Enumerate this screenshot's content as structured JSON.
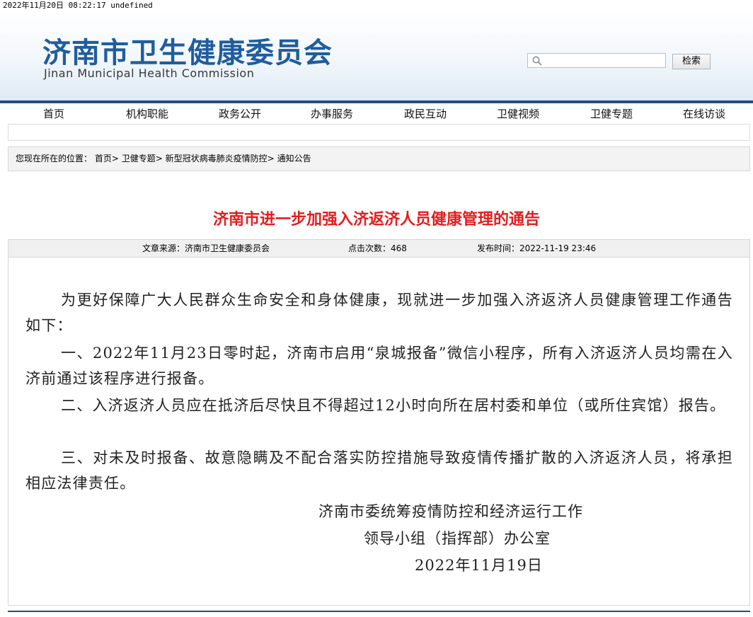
{
  "timestamp": "2022年11月20日  08:22:17  undefined",
  "header": {
    "name_cn": "济南市卫生健康委员会",
    "name_en": "Jinan Municipal Health Commission",
    "search_placeholder": "",
    "search_button": "检索"
  },
  "nav": {
    "items": [
      {
        "label": "首页"
      },
      {
        "label": "机构职能"
      },
      {
        "label": "政务公开"
      },
      {
        "label": "办事服务"
      },
      {
        "label": "政民互动"
      },
      {
        "label": "卫健视频"
      },
      {
        "label": "卫健专题"
      },
      {
        "label": "在线访谈"
      }
    ]
  },
  "breadcrumb": {
    "prefix": "您现在所在的位置：",
    "items": [
      {
        "label": "首页"
      },
      {
        "label": "卫健专题"
      },
      {
        "label": "新型冠状病毒肺炎疫情防控"
      },
      {
        "label": "通知公告"
      }
    ],
    "separator": ">"
  },
  "article": {
    "title": "济南市进一步加强入济返济人员健康管理的通告",
    "source": "文章来源：济南市卫生健康委员会",
    "views": "点击次数：468",
    "published": "发布时间：2022-11-19 23:46",
    "paragraphs": [
      "为更好保障广大人民群众生命安全和身体健康，现就进一步加强入济返济人员健康管理工作通告如下：",
      "一、2022年11月23日零时起，济南市启用“泉城报备”微信小程序，所有入济返济人员均需在入济前通过该程序进行报备。",
      "二、入济返济人员应在抵济后尽快且不得超过12小时向所在居村委和单位（或所住宾馆）报告。",
      "三、对未及时报备、故意隐瞒及不配合落实防控措施导致疫情传播扩散的入济返济人员，将承担相应法律责任。"
    ],
    "signature": [
      "济南市委统筹疫情防控和经济运行工作",
      "领导小组（指挥部）办公室",
      "2022年11月19日"
    ]
  },
  "colors": {
    "brand_blue": "#1f5d9d",
    "nav_line": "#1f4f82",
    "title_red": "#e41d1d"
  },
  "icons": {
    "search": "magnifier-icon"
  }
}
